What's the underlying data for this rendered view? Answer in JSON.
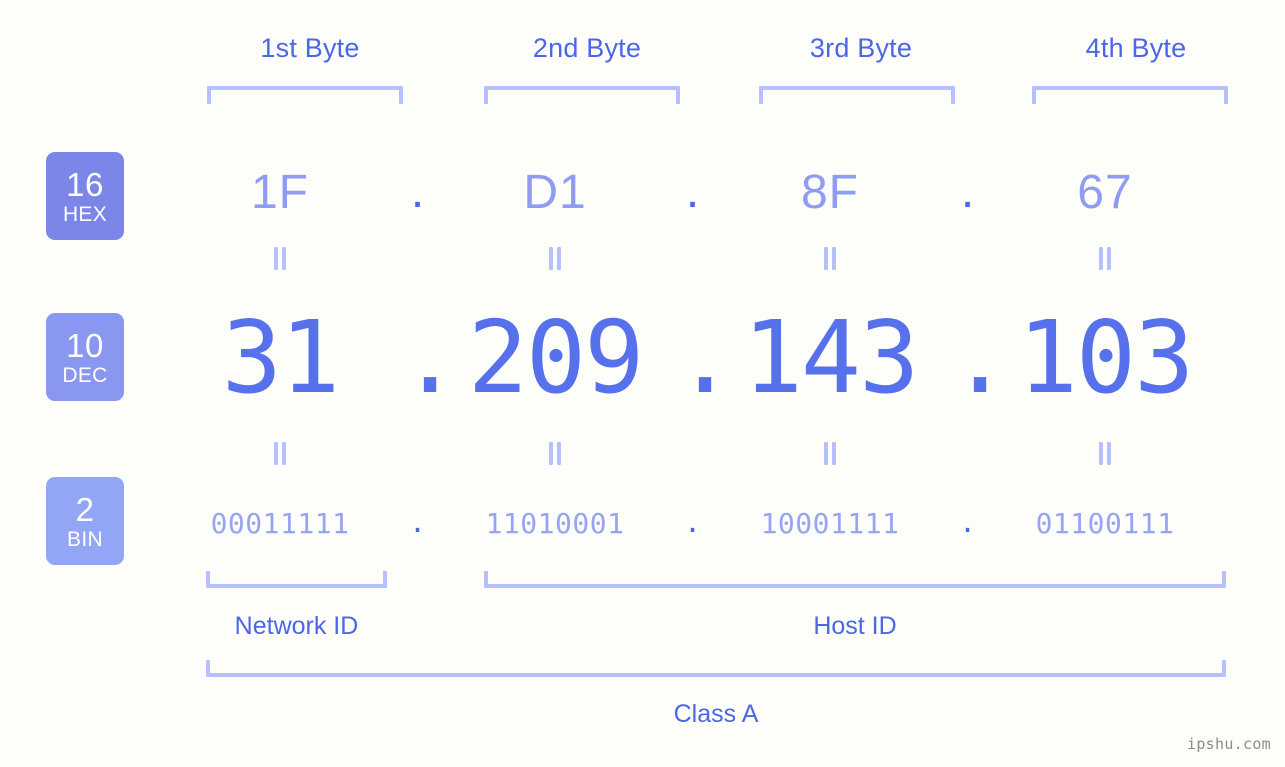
{
  "background_color": "#fdfdfa",
  "colors": {
    "accent_strong": "#4c66e8",
    "accent_dec": "#5770ec",
    "accent_hex": "#8f9cf2",
    "accent_bin": "#97a4f4",
    "bracket": "#b6c0fb",
    "badge_hex": "#7b86e8",
    "badge_dec": "#8a97f0",
    "badge_bin": "#93a6f5",
    "watermark": "#8c8c8c"
  },
  "byte_headers": [
    {
      "label": "1st Byte"
    },
    {
      "label": "2nd Byte"
    },
    {
      "label": "3rd Byte"
    },
    {
      "label": "4th Byte"
    }
  ],
  "bases": [
    {
      "number": "16",
      "name": "HEX"
    },
    {
      "number": "10",
      "name": "DEC"
    },
    {
      "number": "2",
      "name": "BIN"
    }
  ],
  "separator": ".",
  "equality_symbol": "=",
  "rows": {
    "hex": {
      "base": 16,
      "values": [
        "1F",
        "D1",
        "8F",
        "67"
      ]
    },
    "dec": {
      "base": 10,
      "values": [
        "31",
        "209",
        "143",
        "103"
      ]
    },
    "bin": {
      "base": 2,
      "values": [
        "00011111",
        "11010001",
        "10001111",
        "01100111"
      ]
    }
  },
  "ip_address": {
    "dec": "31.209.143.103",
    "hex": "1F.D1.8F.67",
    "bin": "00011111.11010001.10001111.01100111"
  },
  "regions": {
    "network_id": {
      "label": "Network ID",
      "bytes": [
        1
      ]
    },
    "host_id": {
      "label": "Host ID",
      "bytes": [
        2,
        3,
        4
      ]
    },
    "class": {
      "label": "Class A"
    }
  },
  "watermark": "ipshu.com"
}
